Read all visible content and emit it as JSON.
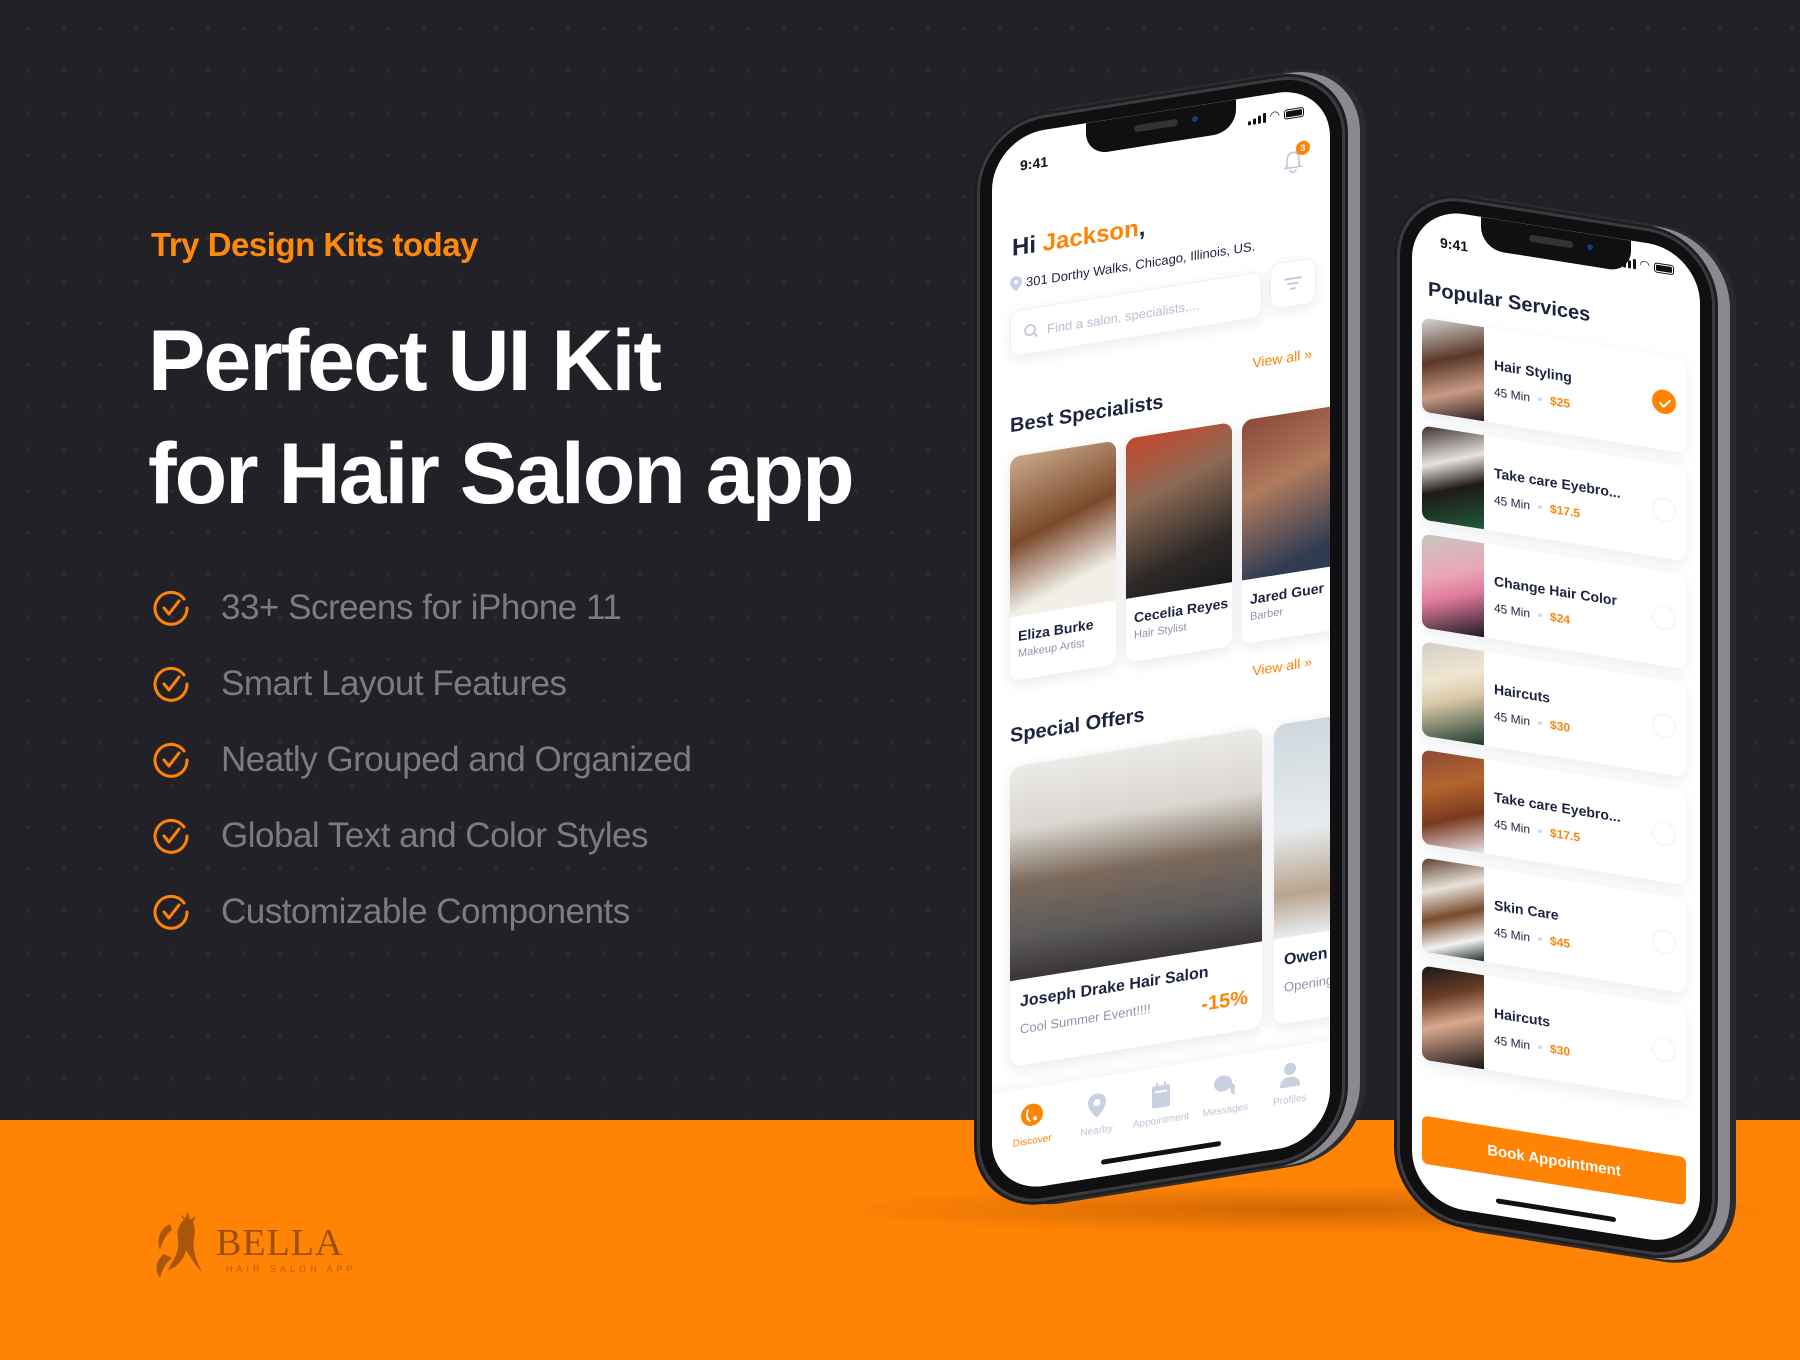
{
  "colors": {
    "accent": "#ff8305",
    "background": "#222128",
    "navy": "#1c2340",
    "muted": "#7b7b83"
  },
  "hero": {
    "eyebrow": "Try Design Kits today",
    "headline_line1": "Perfect UI Kit",
    "headline_line2": "for Hair Salon app",
    "features": [
      "33+ Screens for iPhone 11",
      "Smart Layout Features",
      "Neatly Grouped and Organized",
      "Global Text and Color Styles",
      "Customizable Components"
    ]
  },
  "logo": {
    "name": "BELLA",
    "tagline": "HAIR SALON APP"
  },
  "phone_home": {
    "status_time": "9:41",
    "notification_count": "3",
    "greeting_prefix": "Hi ",
    "user_name": "Jackson",
    "greeting_suffix": ",",
    "address": "301 Dorthy Walks, Chicago, Illinois, US.",
    "search_placeholder": "Find a salon, specialists,...",
    "specialists_title": "Best Specialists",
    "view_all": "View all »",
    "specialists": [
      {
        "name": "Eliza Burke",
        "role": "Makeup Artist"
      },
      {
        "name": "Cecelia Reyes",
        "role": "Hair Stylist"
      },
      {
        "name": "Jared Guer",
        "role": "Barber"
      }
    ],
    "offers_title": "Special Offers",
    "offers": [
      {
        "name": "Joseph Drake Hair Salon",
        "subtitle": "Cool Summer Event!!!!",
        "discount": "-15%"
      },
      {
        "name": "Owen I",
        "subtitle": "Opening",
        "discount": ""
      }
    ],
    "tabs": [
      {
        "label": "Discover",
        "icon": "compass-icon",
        "active": true
      },
      {
        "label": "Nearby",
        "icon": "location-pin-icon",
        "active": false
      },
      {
        "label": "Appointment",
        "icon": "calendar-icon",
        "active": false
      },
      {
        "label": "Messages",
        "icon": "chat-bubbles-icon",
        "active": false
      },
      {
        "label": "Profiles",
        "icon": "user-icon",
        "active": false
      }
    ]
  },
  "phone_services": {
    "status_time": "9:41",
    "title": "Popular Services",
    "services": [
      {
        "name": "Hair Styling",
        "duration": "45 Min",
        "price": "$25",
        "selected": true
      },
      {
        "name": "Take care Eyebro...",
        "duration": "45 Min",
        "price": "$17.5",
        "selected": false
      },
      {
        "name": "Change Hair Color",
        "duration": "45 Min",
        "price": "$24",
        "selected": false
      },
      {
        "name": "Haircuts",
        "duration": "45 Min",
        "price": "$30",
        "selected": false
      },
      {
        "name": "Take care Eyebro...",
        "duration": "45 Min",
        "price": "$17.5",
        "selected": false
      },
      {
        "name": "Skin Care",
        "duration": "45 Min",
        "price": "$45",
        "selected": false
      },
      {
        "name": "Haircuts",
        "duration": "45 Min",
        "price": "$30",
        "selected": false
      }
    ],
    "book_label": "Book Appointment"
  }
}
